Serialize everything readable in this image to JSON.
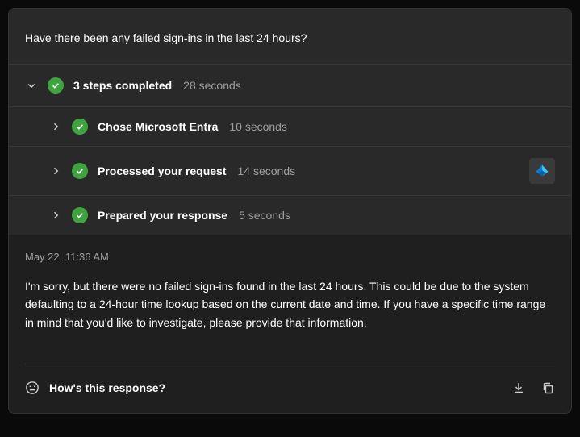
{
  "query": "Have there been any failed sign-ins in the last 24 hours?",
  "summary": {
    "label": "3 steps completed",
    "duration": "28 seconds"
  },
  "steps": [
    {
      "label": "Chose Microsoft Entra",
      "duration": "10 seconds",
      "icon": false
    },
    {
      "label": "Processed your request",
      "duration": "14 seconds",
      "icon": true
    },
    {
      "label": "Prepared your response",
      "duration": "5 seconds",
      "icon": false
    }
  ],
  "timestamp": "May 22, 11:36 AM",
  "response": "I'm sorry, but there were no failed sign-ins found in the last 24 hours. This could be due to the system defaulting to a 24-hour time lookup based on the current date and time. If you have a specific time range in mind that you'd like to investigate, please provide that information.",
  "feedback_prompt": "How's this response?"
}
